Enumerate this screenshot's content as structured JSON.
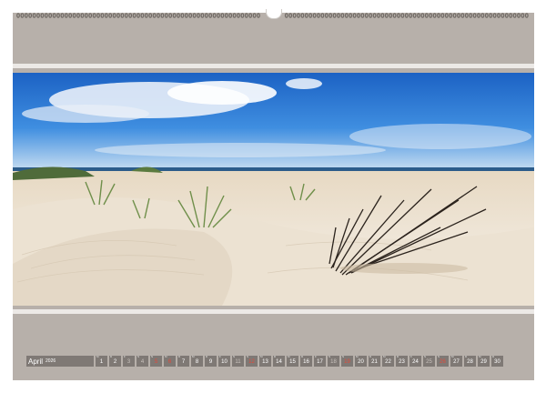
{
  "calendar": {
    "month": "April",
    "year": "2026",
    "days": [
      {
        "wd": "M",
        "num": "1",
        "kind": "weekday"
      },
      {
        "wd": "D",
        "num": "2",
        "kind": "weekday"
      },
      {
        "wd": "F",
        "num": "3",
        "kind": "sat"
      },
      {
        "wd": "S",
        "num": "4",
        "kind": "sat"
      },
      {
        "wd": "S",
        "num": "5",
        "kind": "sun"
      },
      {
        "wd": "M",
        "num": "6",
        "kind": "sun"
      },
      {
        "wd": "D",
        "num": "7",
        "kind": "weekday"
      },
      {
        "wd": "M",
        "num": "8",
        "kind": "weekday"
      },
      {
        "wd": "D",
        "num": "9",
        "kind": "weekday"
      },
      {
        "wd": "F",
        "num": "10",
        "kind": "weekday"
      },
      {
        "wd": "S",
        "num": "11",
        "kind": "sat"
      },
      {
        "wd": "S",
        "num": "12",
        "kind": "sun"
      },
      {
        "wd": "M",
        "num": "13",
        "kind": "weekday"
      },
      {
        "wd": "D",
        "num": "14",
        "kind": "weekday"
      },
      {
        "wd": "M",
        "num": "15",
        "kind": "weekday"
      },
      {
        "wd": "D",
        "num": "16",
        "kind": "weekday"
      },
      {
        "wd": "F",
        "num": "17",
        "kind": "weekday"
      },
      {
        "wd": "S",
        "num": "18",
        "kind": "sat"
      },
      {
        "wd": "S",
        "num": "19",
        "kind": "sun"
      },
      {
        "wd": "M",
        "num": "20",
        "kind": "weekday"
      },
      {
        "wd": "D",
        "num": "21",
        "kind": "weekday"
      },
      {
        "wd": "M",
        "num": "22",
        "kind": "weekday"
      },
      {
        "wd": "D",
        "num": "23",
        "kind": "weekday"
      },
      {
        "wd": "F",
        "num": "24",
        "kind": "weekday"
      },
      {
        "wd": "S",
        "num": "25",
        "kind": "sat"
      },
      {
        "wd": "S",
        "num": "26",
        "kind": "sun"
      },
      {
        "wd": "M",
        "num": "27",
        "kind": "weekday"
      },
      {
        "wd": "D",
        "num": "28",
        "kind": "weekday"
      },
      {
        "wd": "M",
        "num": "29",
        "kind": "weekday"
      },
      {
        "wd": "D",
        "num": "30",
        "kind": "weekday"
      }
    ]
  },
  "colors": {
    "page": "#b7b0aa",
    "bar": "#7f7975",
    "sunday": "#e24a3b",
    "saturday": "#c9c2bd"
  },
  "photo": {
    "icon": "beach-dunes-photo"
  }
}
